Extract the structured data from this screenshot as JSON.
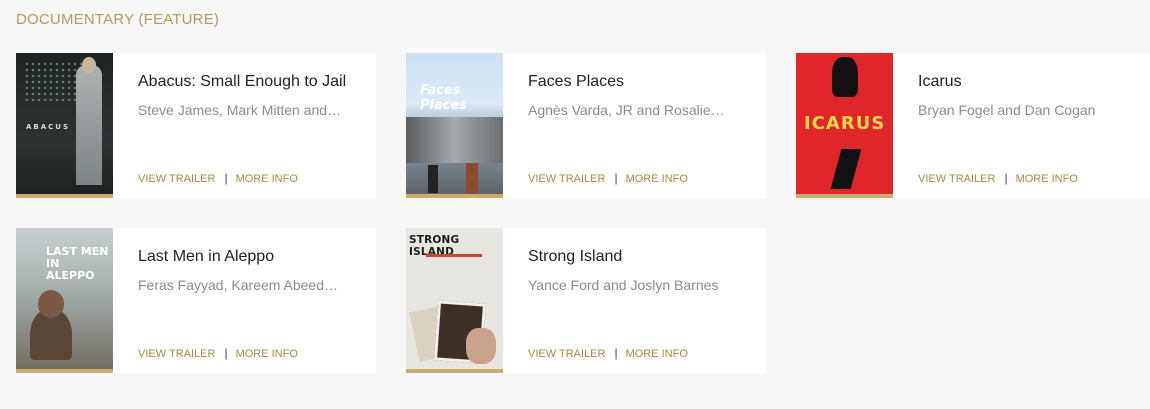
{
  "section": {
    "title": "DOCUMENTARY (FEATURE)"
  },
  "films": [
    {
      "title": "Abacus: Small Enough to Jail",
      "names": "Steve James, Mark Mitten and…",
      "trailer": "VIEW TRAILER",
      "info": "MORE INFO",
      "poster_text": "ABACUS"
    },
    {
      "title": "Faces Places",
      "names": "Agnès Varda, JR and Rosalie…",
      "trailer": "VIEW TRAILER",
      "info": "MORE INFO",
      "poster_text": "Faces Places"
    },
    {
      "title": "Icarus",
      "names": "Bryan Fogel and Dan Cogan",
      "trailer": "VIEW TRAILER",
      "info": "MORE INFO",
      "poster_text": "ICARUS"
    },
    {
      "title": "Last Men in Aleppo",
      "names": "Feras Fayyad, Kareem Abeed…",
      "trailer": "VIEW TRAILER",
      "info": "MORE INFO",
      "poster_text": "LAST MEN IN ALEPPO"
    },
    {
      "title": "Strong Island",
      "names": "Yance Ford and Joslyn Barnes",
      "trailer": "VIEW TRAILER",
      "info": "MORE INFO",
      "poster_text": "STRONG ISLAND"
    }
  ],
  "separator": "|"
}
